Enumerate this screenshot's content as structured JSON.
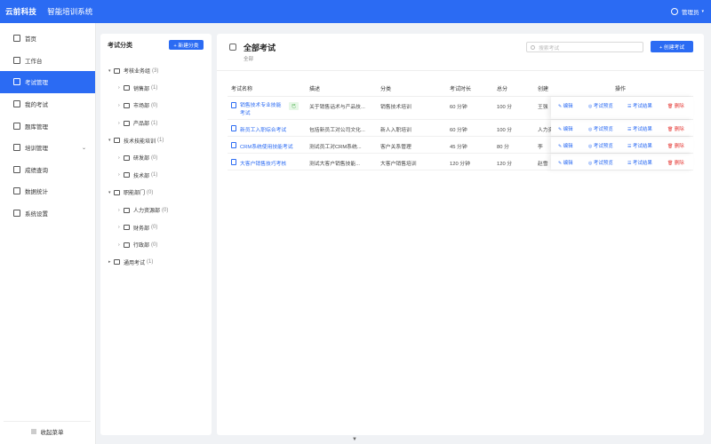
{
  "header": {
    "brand": "云前科技",
    "system_name": "智能培训系统",
    "user_name": "管理员"
  },
  "sidebar": {
    "items": [
      {
        "label": "首页",
        "icon": "home-icon",
        "active": false
      },
      {
        "label": "工作台",
        "icon": "desk-icon",
        "active": false
      },
      {
        "label": "考试管理",
        "icon": "exam-icon",
        "active": true
      },
      {
        "label": "我的考试",
        "icon": "myexam-icon",
        "active": false
      },
      {
        "label": "题库管理",
        "icon": "bank-icon",
        "active": false
      },
      {
        "label": "培训管理",
        "icon": "training-icon",
        "active": false,
        "has_children": true
      },
      {
        "label": "成绩查询",
        "icon": "score-icon",
        "active": false
      },
      {
        "label": "数据统计",
        "icon": "stats-icon",
        "active": false
      },
      {
        "label": "系统设置",
        "icon": "settings-icon",
        "active": false
      }
    ],
    "collapse_label": "收起菜单"
  },
  "category_panel": {
    "title": "考试分类",
    "new_button": "+ 新建分类",
    "tree": [
      {
        "label": "考核业务组",
        "count": "(3)",
        "level": 0,
        "expanded": true
      },
      {
        "label": "销售部",
        "count": "(1)",
        "level": 1
      },
      {
        "label": "市场部",
        "count": "(0)",
        "level": 1
      },
      {
        "label": "产品部",
        "count": "(1)",
        "level": 1
      },
      {
        "label": "技术技能培训",
        "count": "(1)",
        "level": 0,
        "expanded": true
      },
      {
        "label": "研发部",
        "count": "(0)",
        "level": 1
      },
      {
        "label": "技术部",
        "count": "(1)",
        "level": 1
      },
      {
        "label": "职能部门",
        "count": "(0)",
        "level": 0,
        "expanded": true
      },
      {
        "label": "人力资源部",
        "count": "(0)",
        "level": 1
      },
      {
        "label": "财务部",
        "count": "(0)",
        "level": 1
      },
      {
        "label": "行政部",
        "count": "(0)",
        "level": 1
      },
      {
        "label": "通用考试",
        "count": "(1)",
        "level": 0,
        "expanded": false
      }
    ]
  },
  "main": {
    "title": "全部考试",
    "subtitle": "全部",
    "search_placeholder": "搜索考试",
    "create_button": "+ 创建考试",
    "columns": [
      "考试名称",
      "描述",
      "分类",
      "考试时长",
      "总分",
      "创建",
      "操作"
    ],
    "rows": [
      {
        "name": "销售技术专业技能考试",
        "badge": "已",
        "desc": "关于销售话术与产品技...",
        "category": "销售技术培训",
        "duration": "60 分钟",
        "score": "100 分",
        "creator": "王强"
      },
      {
        "name": "新员工入职综合考试",
        "badge": "",
        "desc": "包括新员工对公司文化...",
        "category": "新人入职培训",
        "duration": "60 分钟",
        "score": "100 分",
        "creator": "人力资源"
      },
      {
        "name": "CRM系统使用技能考试",
        "badge": "",
        "desc": "测试员工对CRM系统...",
        "category": "客户关系管理",
        "duration": "45 分钟",
        "score": "80 分",
        "creator": "李"
      },
      {
        "name": "大客户销售技巧考核",
        "badge": "",
        "desc": "测试大客户销售技能...",
        "category": "大客户销售培训",
        "duration": "120 分钟",
        "score": "120 分",
        "creator": "赵雪"
      }
    ],
    "actions": {
      "edit": "编辑",
      "preview": "考试预览",
      "results": "考试结果",
      "delete": "删除"
    }
  }
}
